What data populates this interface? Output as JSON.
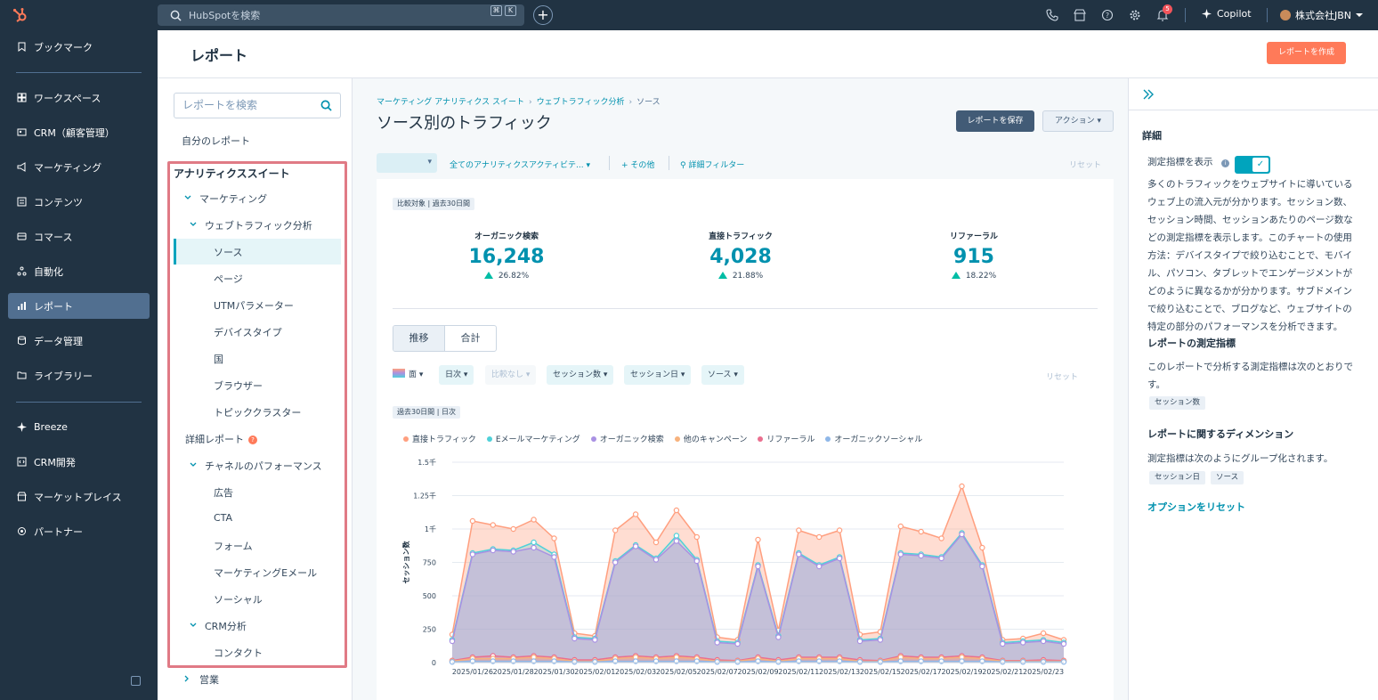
{
  "topbar": {
    "search_placeholder": "HubSpotを検索",
    "kbd1": "⌘",
    "kbd2": "K",
    "notification_count": "5",
    "copilot": "Copilot",
    "account": "株式会社JBN"
  },
  "leftnav": {
    "items": [
      {
        "label": "ブックマーク"
      },
      {
        "label": "ワークスペース"
      },
      {
        "label": "CRM（顧客管理）"
      },
      {
        "label": "マーケティング"
      },
      {
        "label": "コンテンツ"
      },
      {
        "label": "コマース"
      },
      {
        "label": "自動化"
      },
      {
        "label": "レポート"
      },
      {
        "label": "データ管理"
      },
      {
        "label": "ライブラリー"
      },
      {
        "label": "Breeze"
      },
      {
        "label": "CRM開発"
      },
      {
        "label": "マーケットプレイス"
      },
      {
        "label": "パートナー"
      }
    ]
  },
  "header": {
    "title": "レポート",
    "create_button": "レポートを作成"
  },
  "report_sidebar": {
    "search_placeholder": "レポートを検索",
    "my_reports": "自分のレポート",
    "suite_title": "アナリティクススイート",
    "marketing": "マーケティング",
    "web_traffic": "ウェブトラフィック分析",
    "source": "ソース",
    "page": "ページ",
    "utm": "UTMパラメーター",
    "device": "デバイスタイプ",
    "country": "国",
    "browser": "ブラウザー",
    "topic": "トピッククラスター",
    "detail_report": "詳細レポート",
    "channel_perf": "チャネルのパフォーマンス",
    "ads": "広告",
    "cta": "CTA",
    "form": "フォーム",
    "marketing_email": "マーケティングEメール",
    "social": "ソーシャル",
    "crm_analysis": "CRM分析",
    "contact": "コンタクト",
    "sales": "営業"
  },
  "main": {
    "breadcrumb": [
      "マーケティング アナリティクス スイート",
      "ウェブトラフィック分析",
      "ソース"
    ],
    "title": "ソース別のトラフィック",
    "save_button": "レポートを保存",
    "action_button": "アクション",
    "filters": {
      "activity": "全てのアナリティクスアクティビテ...",
      "more": "その他",
      "detail_filter": "詳細フィルター",
      "reset": "リセット"
    },
    "compare_label": "比較対象 | 過去30日間",
    "kpis": [
      {
        "title": "オーガニック検索",
        "value": "16,248",
        "change": "26.82%"
      },
      {
        "title": "直接トラフィック",
        "value": "4,028",
        "change": "21.88%"
      },
      {
        "title": "リファーラル",
        "value": "915",
        "change": "18.22%"
      }
    ],
    "tabs": [
      "推移",
      "合計"
    ],
    "chart_controls": {
      "chart_type": "面",
      "daily": "日次",
      "no_compare": "比較なし",
      "sessions": "セッション数",
      "session_date": "セッション日",
      "source": "ソース",
      "reset": "リセット"
    },
    "period_label": "過去30日間 | 日次"
  },
  "chart_data": {
    "type": "area",
    "ylabel": "セッション数",
    "ylim": [
      0,
      1500
    ],
    "yticks": [
      "0",
      "250",
      "500",
      "750",
      "1千",
      "1.25千",
      "1.5千"
    ],
    "x": [
      "2025/01/25",
      "2025/01/26",
      "2025/01/27",
      "2025/01/28",
      "2025/01/29",
      "2025/01/30",
      "2025/01/31",
      "2025/02/01",
      "2025/02/02",
      "2025/02/03",
      "2025/02/04",
      "2025/02/05",
      "2025/02/06",
      "2025/02/07",
      "2025/02/08",
      "2025/02/09",
      "2025/02/10",
      "2025/02/11",
      "2025/02/12",
      "2025/02/13",
      "2025/02/14",
      "2025/02/15",
      "2025/02/16",
      "2025/02/17",
      "2025/02/18",
      "2025/02/19",
      "2025/02/20",
      "2025/02/21",
      "2025/02/22",
      "2025/02/23",
      "2025/02/24"
    ],
    "xticks": [
      "2025/01/26",
      "2025/01/28",
      "2025/01/30",
      "2025/02/01",
      "2025/02/03",
      "2025/02/05",
      "2025/02/07",
      "2025/02/09",
      "2025/02/11",
      "2025/02/13",
      "2025/02/15",
      "2025/02/17",
      "2025/02/19",
      "2025/02/21",
      "2025/02/23"
    ],
    "series": [
      {
        "name": "直接トラフィック",
        "color": "#ff9f7f",
        "values": [
          210,
          1060,
          1030,
          1000,
          1070,
          930,
          220,
          200,
          990,
          1110,
          900,
          1140,
          940,
          190,
          170,
          920,
          240,
          990,
          940,
          990,
          210,
          230,
          1020,
          980,
          930,
          1320,
          860,
          170,
          180,
          220,
          170
        ]
      },
      {
        "name": "Eメールマーケティング",
        "color": "#4fd1d9",
        "values": [
          170,
          820,
          850,
          840,
          900,
          810,
          190,
          180,
          760,
          880,
          780,
          950,
          770,
          160,
          150,
          730,
          200,
          820,
          730,
          790,
          170,
          180,
          820,
          810,
          790,
          970,
          730,
          150,
          160,
          170,
          150
        ]
      },
      {
        "name": "オーガニック検索",
        "color": "#a991e3",
        "values": [
          160,
          810,
          840,
          830,
          860,
          790,
          180,
          170,
          750,
          870,
          770,
          910,
          760,
          150,
          140,
          720,
          190,
          810,
          720,
          780,
          160,
          170,
          810,
          800,
          780,
          960,
          720,
          140,
          150,
          160,
          140
        ]
      },
      {
        "name": "他のキャンペーン",
        "color": "#f7b27d",
        "values": [
          10,
          30,
          30,
          30,
          40,
          30,
          10,
          10,
          30,
          40,
          30,
          40,
          30,
          10,
          10,
          30,
          10,
          30,
          30,
          30,
          10,
          10,
          40,
          30,
          30,
          40,
          30,
          10,
          10,
          10,
          10
        ]
      },
      {
        "name": "リファーラル",
        "color": "#ea6f8f",
        "values": [
          15,
          40,
          50,
          40,
          50,
          40,
          20,
          20,
          40,
          50,
          40,
          50,
          40,
          20,
          15,
          40,
          20,
          40,
          40,
          40,
          20,
          15,
          50,
          40,
          40,
          50,
          40,
          15,
          15,
          20,
          15
        ]
      },
      {
        "name": "オーガニックソーシャル",
        "color": "#8fb7e8",
        "values": [
          5,
          10,
          10,
          10,
          10,
          10,
          5,
          5,
          10,
          10,
          10,
          10,
          10,
          5,
          5,
          10,
          5,
          10,
          10,
          10,
          5,
          5,
          10,
          10,
          10,
          10,
          10,
          5,
          5,
          5,
          5
        ]
      }
    ]
  },
  "right_panel": {
    "details_title": "詳細",
    "show_metric": "測定指標を表示",
    "description": "多くのトラフィックをウェブサイトに導いているウェブ上の流入元が分かります。セッション数、セッション時間、セッションあたりのページ数などの測定指標を表示します。このチャートの使用方法：デバイスタイプで絞り込むことで、モバイル、パソコン、タブレットでエンゲージメントがどのように異なるかが分かります。サブドメインで絞り込むことで、ブログなど、ウェブサイトの特定の部分のパフォーマンスを分析できます。",
    "metrics_title": "レポートの測定指標",
    "metrics_text": "このレポートで分析する測定指標は次のとおりです。",
    "metric_tag": "セッション数",
    "dims_title": "レポートに関するディメンション",
    "dims_text": "測定指標は次のようにグループ化されます。",
    "dim_tags": [
      "セッション日",
      "ソース"
    ],
    "reset_link": "オプションをリセット"
  },
  "colors": {
    "accent": "#00a4bd",
    "cta": "#ff7a59",
    "nav": "#213343"
  }
}
